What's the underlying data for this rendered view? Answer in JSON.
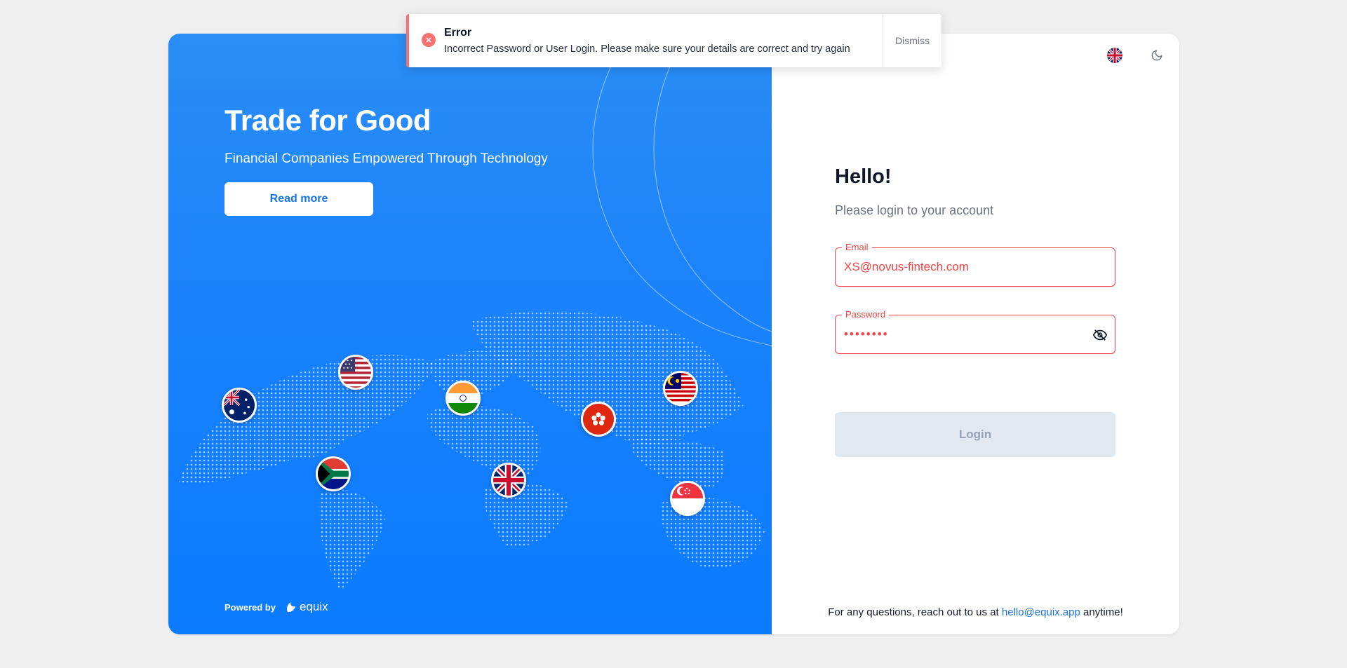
{
  "hero": {
    "title": "Trade for Good",
    "subtitle": "Financial Companies Empowered Through Technology",
    "read_more": "Read more",
    "powered_by": "Powered by",
    "brand": "equix",
    "flags": [
      "australia",
      "united-states",
      "south-africa",
      "india",
      "united-kingdom",
      "hong-kong",
      "malaysia",
      "singapore"
    ]
  },
  "login": {
    "greeting": "Hello!",
    "subtitle": "Please login to your account",
    "email_label": "Email",
    "email_value": "XS@novus-fintech.com",
    "password_label": "Password",
    "password_value": "••••••••",
    "login_button": "Login",
    "footer_prefix": "For any questions, reach out to us at",
    "footer_email": "hello@equix.app",
    "footer_suffix": "anytime!"
  },
  "toast": {
    "title": "Error",
    "message": "Incorrect Password or User Login. Please make sure your details are correct and try again",
    "dismiss": "Dismiss"
  },
  "colors": {
    "hero_blue": "#1a82fb",
    "error": "#ef4444",
    "link": "#1a73e8"
  }
}
